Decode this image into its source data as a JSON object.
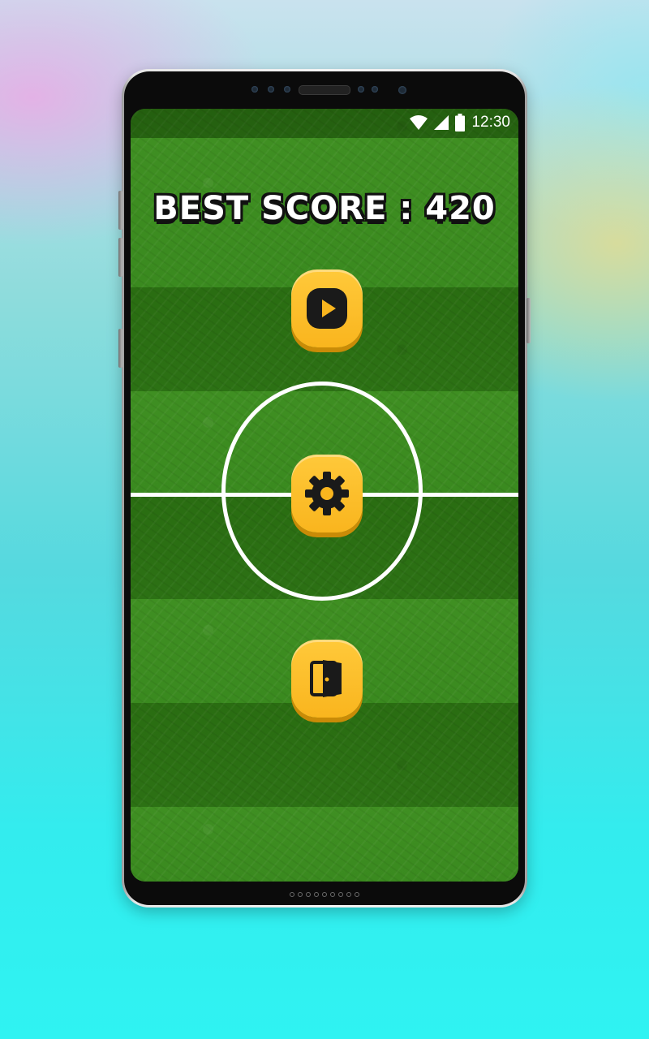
{
  "status_bar": {
    "time": "12:30",
    "icons": [
      "wifi-icon",
      "cellular-signal-icon",
      "battery-icon"
    ]
  },
  "game": {
    "best_score_text": "BEST SCORE : 420",
    "buttons": [
      {
        "name": "play-button",
        "icon": "play-icon"
      },
      {
        "name": "settings-button",
        "icon": "gear-icon"
      },
      {
        "name": "exit-button",
        "icon": "door-exit-icon"
      }
    ]
  },
  "colors": {
    "button_yellow": "#f9b51e",
    "icon_dark": "#1a1a1a",
    "field_light": "#3f8f22",
    "field_dark": "#2a6d12",
    "line_white": "#ffffff"
  }
}
